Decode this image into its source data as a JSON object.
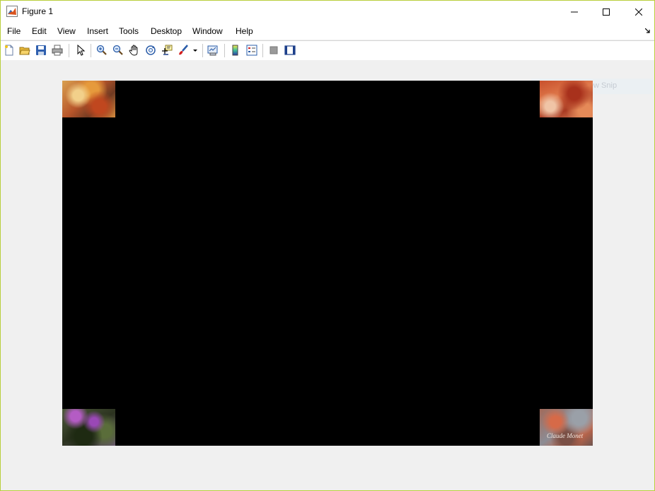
{
  "window": {
    "title": "Figure 1"
  },
  "menu": {
    "items": [
      {
        "label": "File"
      },
      {
        "label": "Edit"
      },
      {
        "label": "View"
      },
      {
        "label": "Insert"
      },
      {
        "label": "Tools"
      },
      {
        "label": "Desktop"
      },
      {
        "label": "Window"
      },
      {
        "label": "Help"
      }
    ]
  },
  "toolbar": {
    "buttons": [
      {
        "icon": "new-figure-icon"
      },
      {
        "icon": "open-file-icon"
      },
      {
        "icon": "save-figure-icon"
      },
      {
        "icon": "print-figure-icon"
      },
      {
        "icon": "edit-plot-icon"
      },
      {
        "icon": "zoom-in-icon"
      },
      {
        "icon": "zoom-out-icon"
      },
      {
        "icon": "pan-icon"
      },
      {
        "icon": "rotate-3d-icon"
      },
      {
        "icon": "data-cursor-icon"
      },
      {
        "icon": "brush-icon"
      },
      {
        "icon": "link-plot-icon"
      },
      {
        "icon": "insert-colorbar-icon"
      },
      {
        "icon": "insert-legend-icon"
      },
      {
        "icon": "hide-plot-tools-icon"
      },
      {
        "icon": "show-plot-tools-icon"
      }
    ]
  },
  "figure": {
    "images": [
      {
        "icon": "autumn-painting-thumbnail"
      },
      {
        "icon": "red-painting-thumbnail"
      },
      {
        "icon": "flower-painting-thumbnail"
      },
      {
        "icon": "signed-painting-thumbnail",
        "signature": "Claude Monet"
      }
    ],
    "ghost_overlay": "New Snip"
  },
  "colors": {
    "window_border": "#b9cf3c",
    "axes_background": "#000000",
    "figure_background": "#f0f0f0"
  }
}
